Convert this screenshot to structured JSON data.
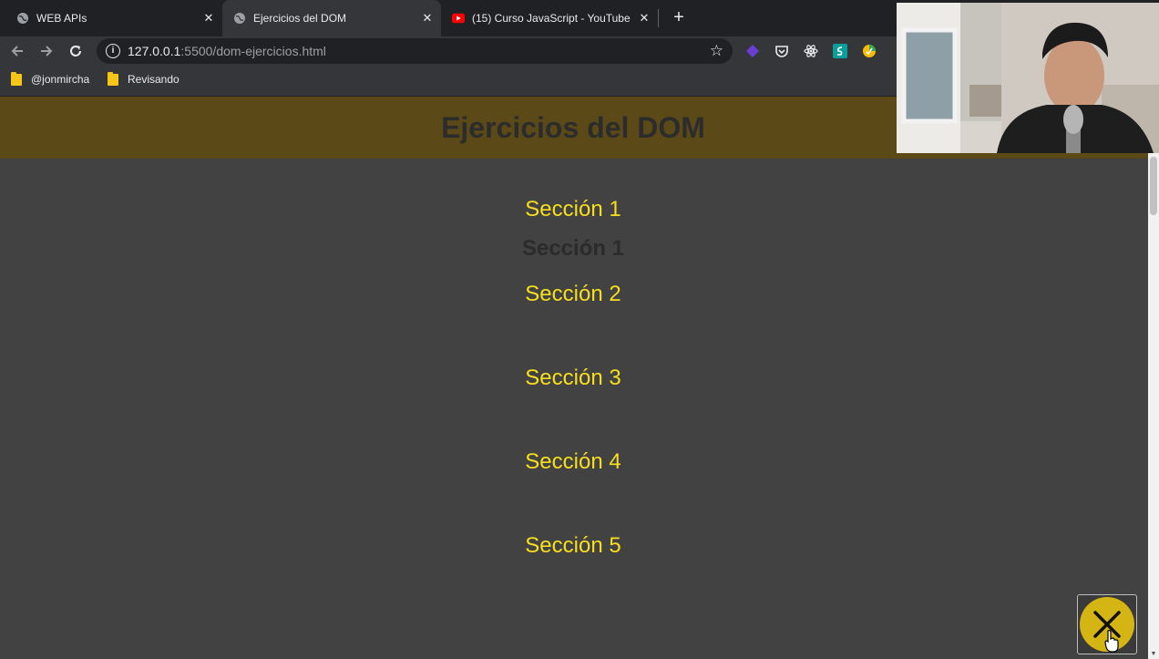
{
  "browser": {
    "tabs": [
      {
        "title": "WEB APIs",
        "icon": "globe-icon",
        "active": false
      },
      {
        "title": "Ejercicios del DOM",
        "icon": "globe-icon",
        "active": true
      },
      {
        "title": "(15) Curso JavaScript - YouTube",
        "icon": "youtube-icon",
        "active": false
      }
    ],
    "url_host": "127.0.0.1",
    "url_rest": ":5500/dom-ejercicios.html",
    "bookmarks": [
      {
        "label": "@jonmircha",
        "icon": "folder-icon"
      },
      {
        "label": "Revisando",
        "icon": "folder-icon"
      }
    ]
  },
  "page": {
    "title": "Ejercicios del DOM",
    "sections": [
      {
        "label": "Sección 1",
        "color": "#f7de1e"
      },
      {
        "label": "Sección 1",
        "color": "#2b2b2b"
      },
      {
        "label": "Sección 2",
        "color": "#f7de1e"
      },
      {
        "label": "Sección 3",
        "color": "#f7de1e"
      },
      {
        "label": "Sección 4",
        "color": "#f7de1e"
      },
      {
        "label": "Sección 5",
        "color": "#f7de1e"
      }
    ],
    "close_button_icon": "close-icon"
  },
  "colors": {
    "header_bg": "#5b4a17",
    "accent": "#f7de1e",
    "page_bg": "#424242"
  }
}
